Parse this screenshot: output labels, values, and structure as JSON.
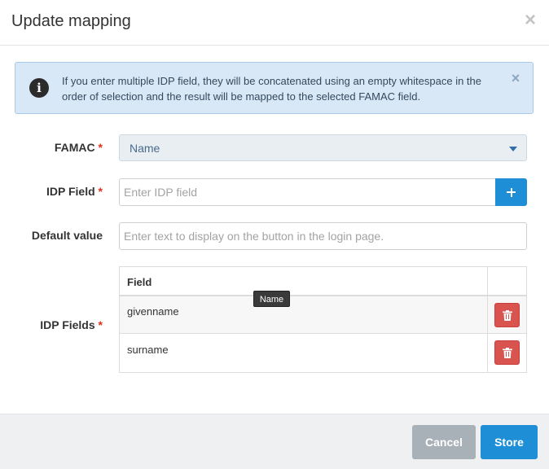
{
  "dialog": {
    "title": "Update mapping",
    "close_glyph": "×"
  },
  "alert": {
    "icon": "info-icon",
    "icon_glyph": "i",
    "text": "If you enter multiple IDP field, they will be concatenated using an empty whitespace in the order of selection and the result will be mapped to the selected FAMAC field.",
    "close_glyph": "×"
  },
  "form": {
    "famac": {
      "label": "FAMAC",
      "required_mark": "*",
      "selected_value": "Name"
    },
    "idp_field": {
      "label": "IDP Field",
      "required_mark": "*",
      "value": "",
      "placeholder": "Enter IDP field",
      "add_icon": "plus-icon"
    },
    "default_value": {
      "label": "Default value",
      "value": "",
      "placeholder": "Enter text to display on the button in the login page."
    },
    "idp_fields": {
      "label": "IDP Fields",
      "required_mark": "*",
      "column_header": "Field",
      "rows": [
        {
          "field": "givenname",
          "action_icon": "trash-icon"
        },
        {
          "field": "surname",
          "action_icon": "trash-icon"
        }
      ],
      "tooltip": "Name"
    }
  },
  "footer": {
    "cancel_label": "Cancel",
    "store_label": "Store"
  },
  "colors": {
    "primary": "#1e8fd6",
    "danger": "#d9534f",
    "required": "#e0301e",
    "alert_bg": "#d9e8f6",
    "cancel": "#a8b0b8"
  }
}
